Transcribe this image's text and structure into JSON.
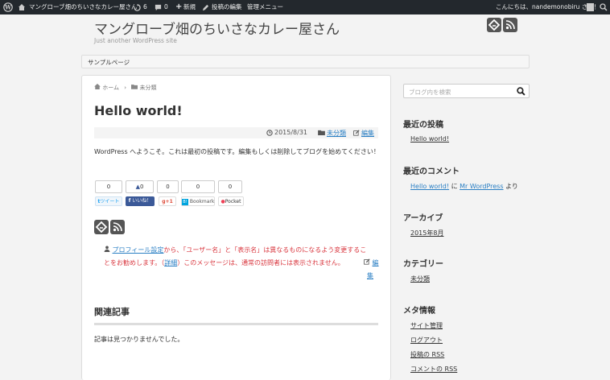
{
  "adminbar": {
    "site_name": "マングローブ畑のちいさなカレー屋さん",
    "updates_count": "6",
    "comments_count": "0",
    "new_label": "新規",
    "edit_post_label": "投稿の編集",
    "admin_menu_label": "管理メニュー",
    "greeting": "こんにちは、nandemonobiru さん！"
  },
  "header": {
    "title": "マングローブ畑のちいさなカレー屋さん",
    "description": "Just another WordPress site"
  },
  "nav": {
    "sample_page": "サンプルページ"
  },
  "breadcrumb": {
    "home": "ホーム",
    "sep": "›",
    "category": "未分類"
  },
  "post": {
    "title": "Hello world!",
    "date": "2015/8/31",
    "category": "未分類",
    "edit": "編集",
    "content": "WordPress へようこそ。これは最初の投稿です。編集もしくは削除してブログを始めてください！"
  },
  "share": {
    "counts": [
      "0",
      "0",
      "0",
      "0",
      "0"
    ],
    "twitter": "ツイート",
    "facebook": "いいね！",
    "gplus": "+1",
    "hatena": "Bookmark",
    "pocket": "Pocket"
  },
  "author_notice": {
    "link1": "プロフィール設定",
    "text1": "から、「ユーザー名」と「表示名」は異なるものになるよう変更するこ",
    "text2": "とをお勧めします。（",
    "link2": "詳細",
    "text3": "）このメッセージは、通常の訪問者には表示されません。",
    "edit1": "編",
    "edit2": "集"
  },
  "related": {
    "title": "関連記事",
    "empty": "記事は見つかりませんでした。"
  },
  "sidebar": {
    "search_placeholder": "ブログ内を検索",
    "recent_posts_title": "最近の投稿",
    "recent_post": "Hello world!",
    "recent_comments_title": "最近のコメント",
    "comment_post": "Hello world!",
    "comment_on": "に",
    "comment_author": "Mr WordPress",
    "comment_from": "より",
    "archives_title": "アーカイブ",
    "archive_item": "2015年8月",
    "categories_title": "カテゴリー",
    "category_item": "未分類",
    "meta_title": "メタ情報",
    "meta_items": [
      "サイト管理",
      "ログアウト",
      "投稿の RSS",
      "コメントの RSS"
    ]
  },
  "colors": {
    "link": "#2a7fc4",
    "notice_red": "#d9363e",
    "adminbar": "#23282d"
  }
}
